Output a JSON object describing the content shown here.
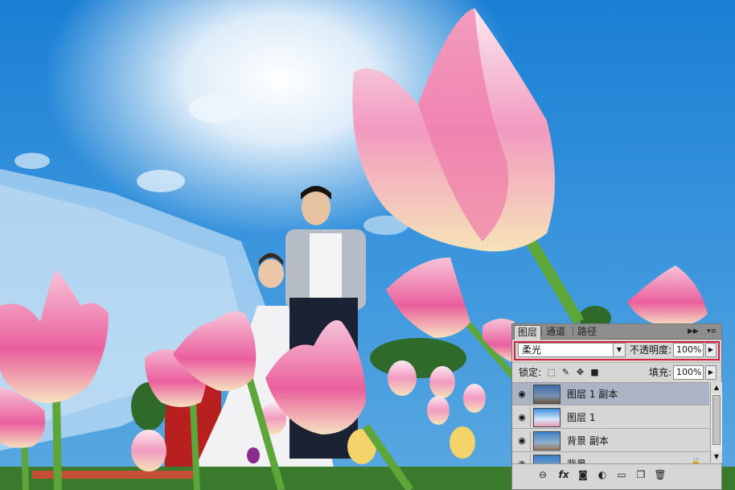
{
  "layers_panel": {
    "tabs": [
      {
        "label": "图层",
        "active": true
      },
      {
        "label": "通道",
        "active": false
      },
      {
        "label": "路径",
        "active": false
      }
    ],
    "menu_icon": "panel-menu-icon",
    "collapse_icon": "double-arrow-icon",
    "blend_mode": "柔光",
    "opacity_label": "不透明度:",
    "opacity_value": "100%",
    "lock_label": "锁定:",
    "fill_label": "填充:",
    "fill_value": "100%",
    "layers": [
      {
        "name": "图层 1 副本",
        "selected": true,
        "visible": true
      },
      {
        "name": "图层 1",
        "selected": false,
        "visible": true
      },
      {
        "name": "背景 副本",
        "selected": false,
        "visible": true
      },
      {
        "name": "背景",
        "selected": false,
        "visible": true,
        "locked": true
      }
    ],
    "bottom_icons": [
      "link-icon",
      "fx-icon",
      "mask-icon",
      "adjustment-icon",
      "group-folder-icon",
      "new-layer-icon",
      "trash-icon"
    ],
    "fx_label": "fx",
    "highlight_color": "#d8213a"
  }
}
